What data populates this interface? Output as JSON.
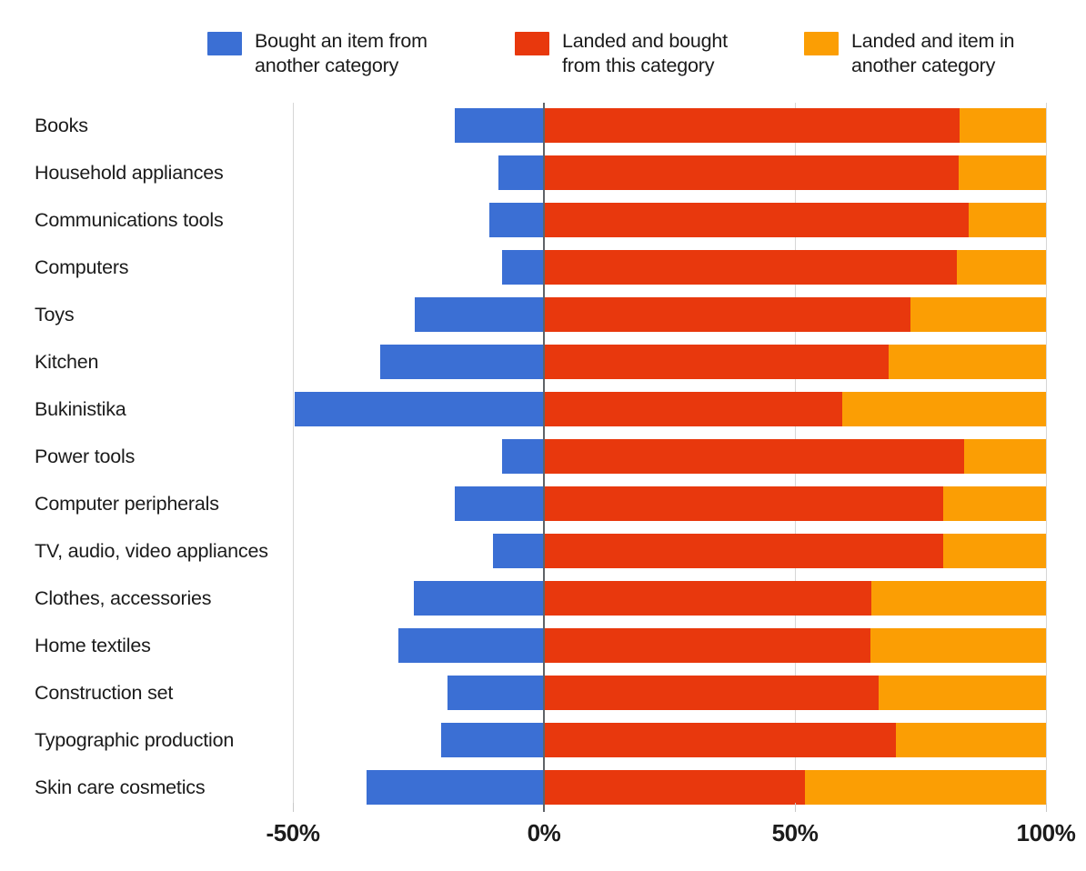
{
  "legend": {
    "position": "top",
    "items": [
      {
        "label": "Bought an item from\nanother category",
        "color": "#3b6fd4",
        "icon": "legend-swatch-blue"
      },
      {
        "label": "Landed and bought\nfrom this category",
        "color": "#e8380d",
        "icon": "legend-swatch-red"
      },
      {
        "label": "Landed and item in\nanother category",
        "color": "#fb9e04",
        "icon": "legend-swatch-orange"
      }
    ]
  },
  "axis": {
    "x_ticks": [
      "-50%",
      "0%",
      "50%",
      "100%"
    ],
    "x_tick_values": [
      -50,
      0,
      50,
      100
    ],
    "xmin": -55,
    "xmax": 100
  },
  "chart_data": {
    "type": "bar",
    "title": "",
    "subtitle": "",
    "xlabel": "",
    "ylabel": "",
    "orientation": "horizontal",
    "stacked": true,
    "grid": true,
    "legend_position": "top",
    "xlim": [
      -55,
      100
    ],
    "xticks": [
      -50,
      0,
      50,
      100
    ],
    "xtick_labels": [
      "-50%",
      "0%",
      "50%",
      "100%"
    ],
    "categories": [
      "Books",
      "Household appliances",
      "Communications tools",
      "Computers",
      "Toys",
      "Kitchen",
      "Bukinistika",
      "Power tools",
      "Computer peripherals",
      "TV, audio, video appliances",
      "Clothes, accessories",
      "Home textiles",
      "Construction set",
      "Typographic production",
      "Skin care cosmetics"
    ],
    "series": [
      {
        "name": "Bought an item from another category",
        "color": "#3b6fd4",
        "values": [
          -17.8,
          -9.1,
          -10.9,
          -8.4,
          -25.7,
          -32.6,
          -49.6,
          -8.4,
          -17.8,
          -10.1,
          -25.9,
          -29.0,
          -19.2,
          -20.5,
          -35.3
        ]
      },
      {
        "name": "Landed and bought from this category",
        "color": "#e8380d",
        "values": [
          82.8,
          82.6,
          84.6,
          82.2,
          73.0,
          68.7,
          59.4,
          83.7,
          79.5,
          79.5,
          65.2,
          65.0,
          66.7,
          70.1,
          52.0
        ]
      },
      {
        "name": "Landed and item in another category",
        "color": "#fb9e04",
        "values": [
          17.2,
          17.4,
          15.4,
          17.8,
          27.0,
          31.3,
          40.6,
          16.3,
          20.5,
          20.5,
          34.8,
          35.0,
          33.3,
          29.9,
          48.0
        ]
      }
    ]
  }
}
